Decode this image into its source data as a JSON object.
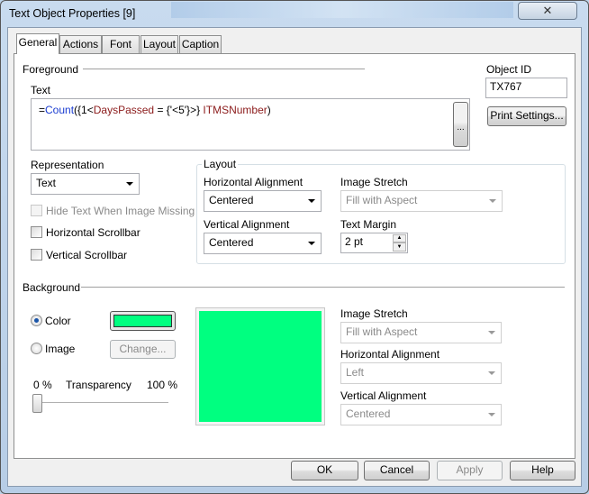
{
  "window": {
    "title": "Text Object Properties [9]",
    "close_label": "✕"
  },
  "tabs": [
    {
      "label": "General",
      "active": true
    },
    {
      "label": "Actions"
    },
    {
      "label": "Font"
    },
    {
      "label": "Layout"
    },
    {
      "label": "Caption"
    }
  ],
  "foreground": {
    "section_label": "Foreground",
    "text_label": "Text",
    "expression": {
      "eq": "=",
      "func": "Count",
      "set_open": "({1<",
      "field1": "DaysPassed",
      "set_mid": " = {'<5'}>} ",
      "field2": "ITMSNumber",
      "close": ")"
    },
    "ellipsis_label": "...",
    "object_id_label": "Object ID",
    "object_id_value": "TX767",
    "print_settings_label": "Print Settings...",
    "representation_label": "Representation",
    "representation_value": "Text",
    "hide_text_label": "Hide Text When Image Missing",
    "horizontal_scrollbar_label": "Horizontal Scrollbar",
    "vertical_scrollbar_label": "Vertical Scrollbar",
    "layout": {
      "label": "Layout",
      "h_align_label": "Horizontal Alignment",
      "h_align_value": "Centered",
      "v_align_label": "Vertical Alignment",
      "v_align_value": "Centered",
      "image_stretch_label": "Image Stretch",
      "image_stretch_value": "Fill with Aspect",
      "text_margin_label": "Text Margin",
      "text_margin_value": "2 pt"
    }
  },
  "background": {
    "section_label": "Background",
    "color_label": "Color",
    "image_label": "Image",
    "change_label": "Change...",
    "selected": "Color",
    "color": "#00ff80",
    "transparency_label": "Transparency",
    "min_label": "0 %",
    "max_label": "100 %",
    "transparency_percent": 0,
    "image_stretch_label": "Image Stretch",
    "image_stretch_value": "Fill with Aspect",
    "h_align_label": "Horizontal Alignment",
    "h_align_value": "Left",
    "v_align_label": "Vertical Alignment",
    "v_align_value": "Centered"
  },
  "buttons": {
    "ok": "OK",
    "cancel": "Cancel",
    "apply": "Apply",
    "help": "Help"
  }
}
